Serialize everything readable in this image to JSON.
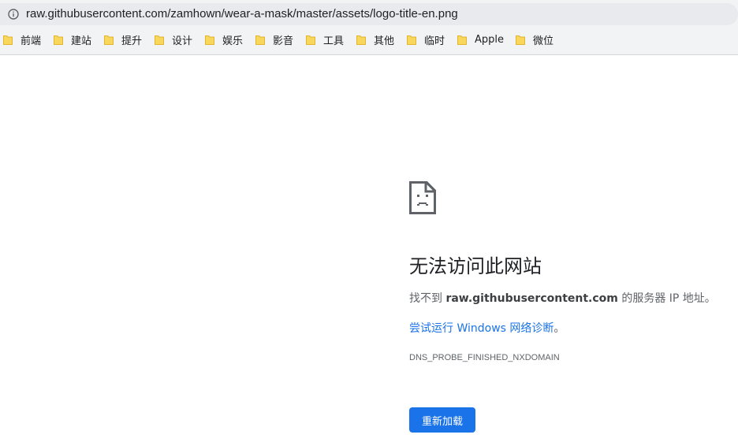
{
  "address_bar": {
    "url": "raw.githubusercontent.com/zamhown/wear-a-mask/master/assets/logo-title-en.png",
    "icon": "info-icon"
  },
  "bookmarks": [
    {
      "label": "前端",
      "icon": "folder-icon"
    },
    {
      "label": "建站",
      "icon": "folder-icon"
    },
    {
      "label": "提升",
      "icon": "folder-icon"
    },
    {
      "label": "设计",
      "icon": "folder-icon"
    },
    {
      "label": "娱乐",
      "icon": "folder-icon"
    },
    {
      "label": "影音",
      "icon": "folder-icon"
    },
    {
      "label": "工具",
      "icon": "folder-icon"
    },
    {
      "label": "其他",
      "icon": "folder-icon"
    },
    {
      "label": "临时",
      "icon": "folder-icon"
    },
    {
      "label": "Apple",
      "icon": "folder-icon"
    },
    {
      "label": "微位",
      "icon": "folder-icon"
    }
  ],
  "error": {
    "icon": "sad-document-icon",
    "title": "无法访问此网站",
    "desc_prefix": "找不到 ",
    "desc_host": "raw.githubusercontent.com",
    "desc_suffix": " 的服务器 IP 地址。",
    "suggestion_link": "尝试运行 Windows 网络诊断",
    "suggestion_tail": "。",
    "error_code": "DNS_PROBE_FINISHED_NXDOMAIN",
    "reload_label": "重新加载"
  },
  "colors": {
    "accent": "#1a73e8",
    "folder": "#f9d65c"
  }
}
